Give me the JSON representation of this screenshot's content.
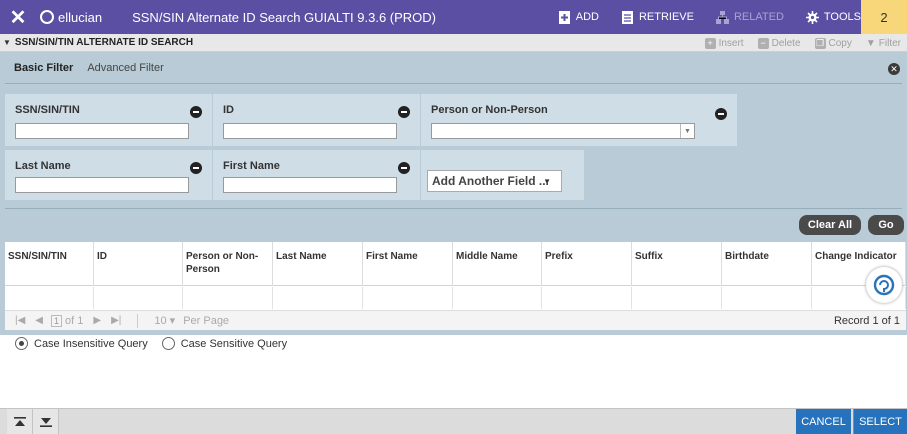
{
  "topbar": {
    "close_icon": "close-icon",
    "brand": "ellucian",
    "title": "SSN/SIN Alternate ID Search GUIALTI 9.3.6 (PROD)",
    "add": "ADD",
    "retrieve": "RETRIEVE",
    "related": "RELATED",
    "tools": "TOOLS",
    "badge": "2",
    "accent": "#5b4fa3",
    "badge_color": "#f7d77a"
  },
  "section": {
    "title": "SSN/SIN/TIN ALTERNATE ID SEARCH",
    "insert": "Insert",
    "delete": "Delete",
    "copy": "Copy",
    "filter": "Filter"
  },
  "filter": {
    "basic_tab": "Basic Filter",
    "advanced_tab": "Advanced Filter",
    "fields": {
      "ssn": {
        "label": "SSN/SIN/TIN",
        "value": ""
      },
      "id": {
        "label": "ID",
        "value": ""
      },
      "person": {
        "label": "Person or Non-Person",
        "value": ""
      },
      "last_name": {
        "label": "Last Name",
        "value": ""
      },
      "first_name": {
        "label": "First Name",
        "value": ""
      }
    },
    "add_field": "Add Another Field ...",
    "clear_all": "Clear All",
    "go": "Go"
  },
  "grid": {
    "columns": [
      "SSN/SIN/TIN",
      "ID",
      "Person or Non-Person",
      "Last Name",
      "First Name",
      "Middle Name",
      "Prefix",
      "Suffix",
      "Birthdate",
      "Change Indicator"
    ]
  },
  "pager": {
    "page": "1",
    "of_label": "of 1",
    "per_page_value": "10",
    "per_page_label": "Per Page",
    "record": "Record 1 of 1"
  },
  "query": {
    "insensitive": "Case Insensitive Query",
    "sensitive": "Case Sensitive Query"
  },
  "footer": {
    "cancel": "CANCEL",
    "select": "SELECT",
    "button_color": "#2672bc"
  }
}
